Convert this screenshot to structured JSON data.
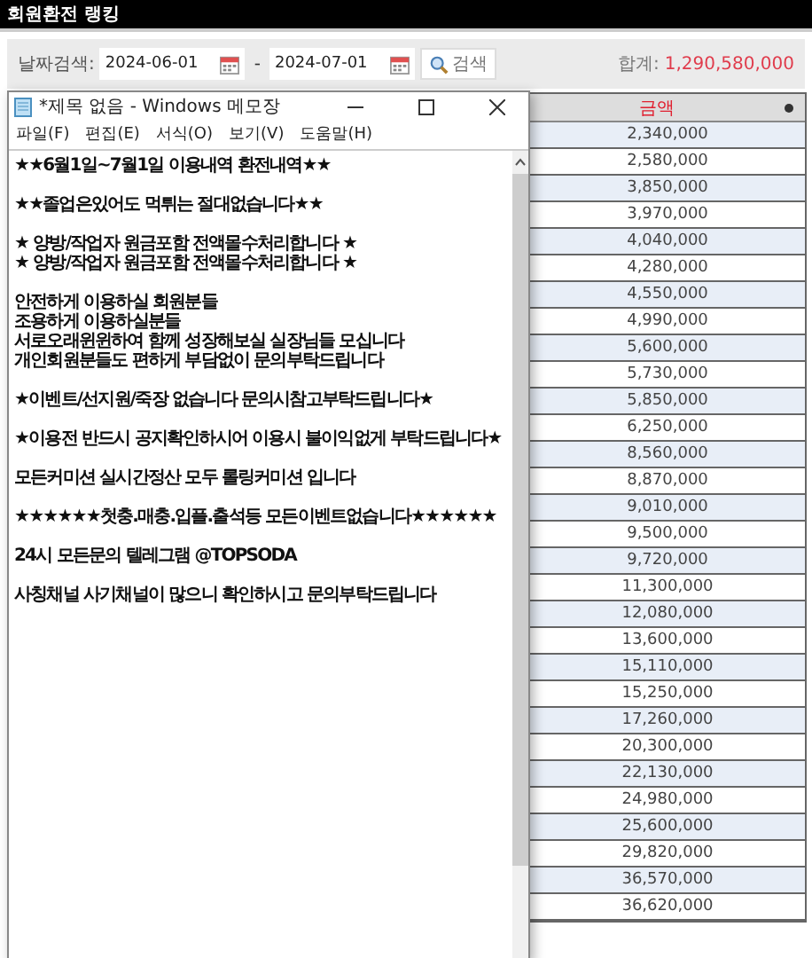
{
  "header": {
    "title": "회원환전 랭킹"
  },
  "filter": {
    "label": "날짜검색:",
    "date_from": "2024-06-01",
    "separator": "-",
    "date_to": "2024-07-01",
    "search_button": "검색",
    "total_label": "합계:",
    "total_value": "1,290,580,000"
  },
  "table": {
    "columns": [
      {
        "label": "금액"
      }
    ],
    "rows": [
      [
        "2,340,000"
      ],
      [
        "2,580,000"
      ],
      [
        "3,850,000"
      ],
      [
        "3,970,000"
      ],
      [
        "4,040,000"
      ],
      [
        "4,280,000"
      ],
      [
        "4,550,000"
      ],
      [
        "4,990,000"
      ],
      [
        "5,600,000"
      ],
      [
        "5,730,000"
      ],
      [
        "5,850,000"
      ],
      [
        "6,250,000"
      ],
      [
        "8,560,000"
      ],
      [
        "8,870,000"
      ],
      [
        "9,010,000"
      ],
      [
        "9,500,000"
      ],
      [
        "9,720,000"
      ],
      [
        "11,300,000"
      ],
      [
        "12,080,000"
      ],
      [
        "13,600,000"
      ],
      [
        "15,110,000"
      ],
      [
        "15,250,000"
      ],
      [
        "17,260,000"
      ],
      [
        "20,300,000"
      ],
      [
        "22,130,000"
      ],
      [
        "24,980,000"
      ],
      [
        "25,600,000"
      ],
      [
        "29,820,000"
      ],
      [
        "36,570,000"
      ],
      [
        "36,620,000"
      ]
    ]
  },
  "notepad": {
    "title": "*제목 없음 - Windows 메모장",
    "menu": [
      "파일(F)",
      "편집(E)",
      "서식(O)",
      "보기(V)",
      "도움말(H)"
    ],
    "paragraphs": [
      [
        "★★6월1일~7월1일 이용내역 환전내역★★"
      ],
      [
        "★★졸업은있어도 먹튀는 절대없습니다★★"
      ],
      [
        "★ 양방/작업자 원금포함 전액몰수처리합니다 ★",
        "★ 양방/작업자 원금포함 전액몰수처리합니다 ★"
      ],
      [
        "안전하게 이용하실 회원분들",
        "조용하게 이용하실분들",
        "서로오래윈윈하여 함께 성장해보실 실장님들 모십니다",
        "개인회원분들도 편하게 부담없이 문의부탁드립니다"
      ],
      [
        "★이벤트/선지원/죽장 없습니다 문의시참고부탁드립니다★"
      ],
      [
        "★이용전 반드시 공지확인하시어 이용시 불이익없게 부탁드립니다★"
      ],
      [
        "모든커미션 실시간정산 모두 롤링커미션 입니다"
      ],
      [
        "★★★★★★첫충.매충.입플.출석등 모든이벤트없습니다★★★★★★"
      ],
      [
        "24시 모든문의 텔레그램 @TOPSODA"
      ],
      [
        "사칭채널 사기채널이 많으니 확인하시고 문의부탁드립니다"
      ]
    ]
  }
}
